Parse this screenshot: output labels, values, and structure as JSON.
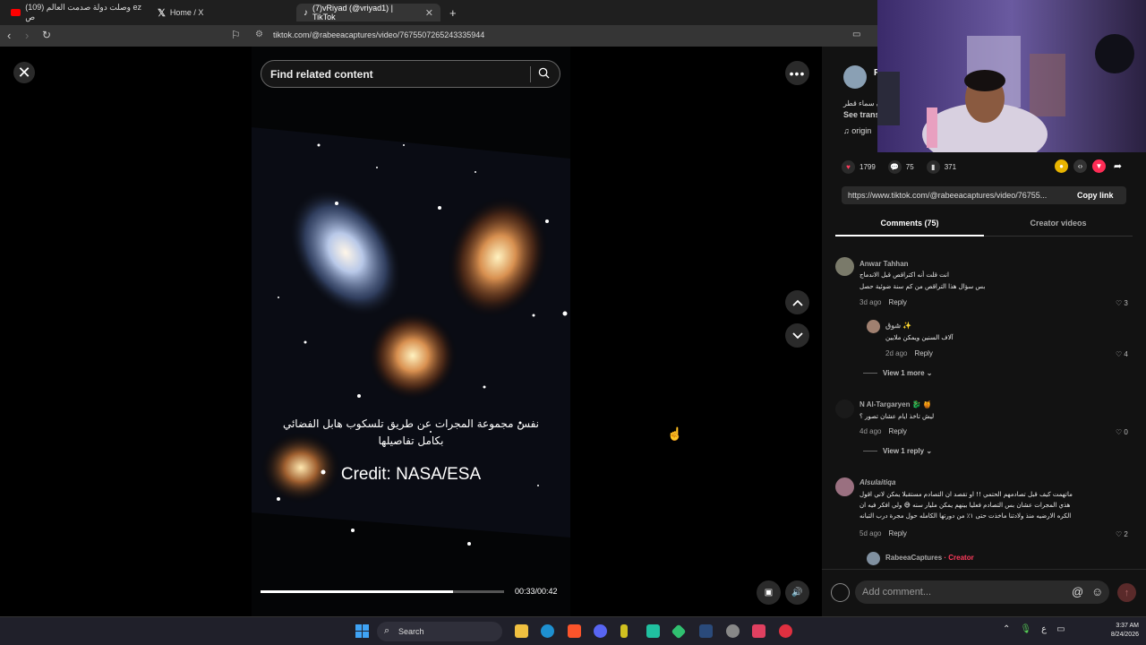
{
  "browser": {
    "tabs": [
      {
        "label": "(109) وصلت دولة صدمت العالم ez ص",
        "icon": "youtube-icon"
      },
      {
        "label": "Home / X",
        "icon": "x-icon"
      },
      {
        "label": "(7)vRiyad (@vriyad1) | TikTok",
        "icon": "tiktok-icon",
        "active": true
      }
    ],
    "new_tab": "+",
    "url": "tiktok.com/@rabeeacaptures/video/7675507265243335944"
  },
  "viewer": {
    "close": "✕",
    "search_placeholder": "Find related content",
    "more": "•••",
    "caption_ar_line1": "نفس مجموعة المجرات عن طريق تلسكوب هابل الفضائي",
    "caption_ar_line2": "بكامل تفاصيلها",
    "credit": "Credit: NASA/ESA",
    "time": "00:33/00:42",
    "progress": 0.79,
    "up": "⌃",
    "down": "⌄"
  },
  "panel": {
    "author_initial": "F",
    "desc_ar": "ن سماء قطر",
    "see_translation": "See trans",
    "music": "origin",
    "likes": "1799",
    "comments_count": "75",
    "saves": "371",
    "link": "https://www.tiktok.com/@rabeeacaptures/video/76755...",
    "copy_link": "Copy link",
    "tab_comments": "Comments (75)",
    "tab_creator": "Creator videos",
    "add_comment": "Add comment...",
    "at": "@",
    "emoji": "☺",
    "send": "↑"
  },
  "comments": [
    {
      "name": "Anwar Tahhan",
      "text1": "انت قلت أنه اكتراقص قبل الاندماج",
      "text2": "بس سؤال هذا التراقص من كم سنة ضوئية حصل",
      "time": "3d ago",
      "reply": "Reply",
      "likes": "3"
    },
    {
      "name": "شوق ✨",
      "text1": "آلاف السنين ويمكن ملايين",
      "time": "2d ago",
      "reply": "Reply",
      "likes": "4"
    },
    {
      "view_more": "View 1 more"
    },
    {
      "name": "N Al-Targaryen 🐉 🍯",
      "text1": "ليش تاخذ ايام عشان تصور ؟",
      "time": "4d ago",
      "reply": "Reply",
      "likes": "0"
    },
    {
      "view_more": "View 1 reply"
    },
    {
      "name": "Alsulaitiqa",
      "text1": "ماتهمت كيف قبل تصادمهم الحتمي !! او تقصد ان التصادم مستقبلا يمكن لاني اقول",
      "text2": "هذي المجرات عشان بس التصادم فعليا بينهم يمكن مليار سنه 😅 ولي افكر فيه ان",
      "text3": "الكره الارضيه منذ ولادتنا ماخذت حتى ١٪ من دورتها الكامله حول مجرة درب التبانه",
      "time": "5d ago",
      "reply": "Reply",
      "likes": "2"
    },
    {
      "name": "RabeeaCaptures",
      "creator_label": "· Creator"
    }
  ],
  "taskbar": {
    "search": "Search",
    "time": "3:37 AM",
    "date": "8/24/2026",
    "lang": "ع"
  }
}
